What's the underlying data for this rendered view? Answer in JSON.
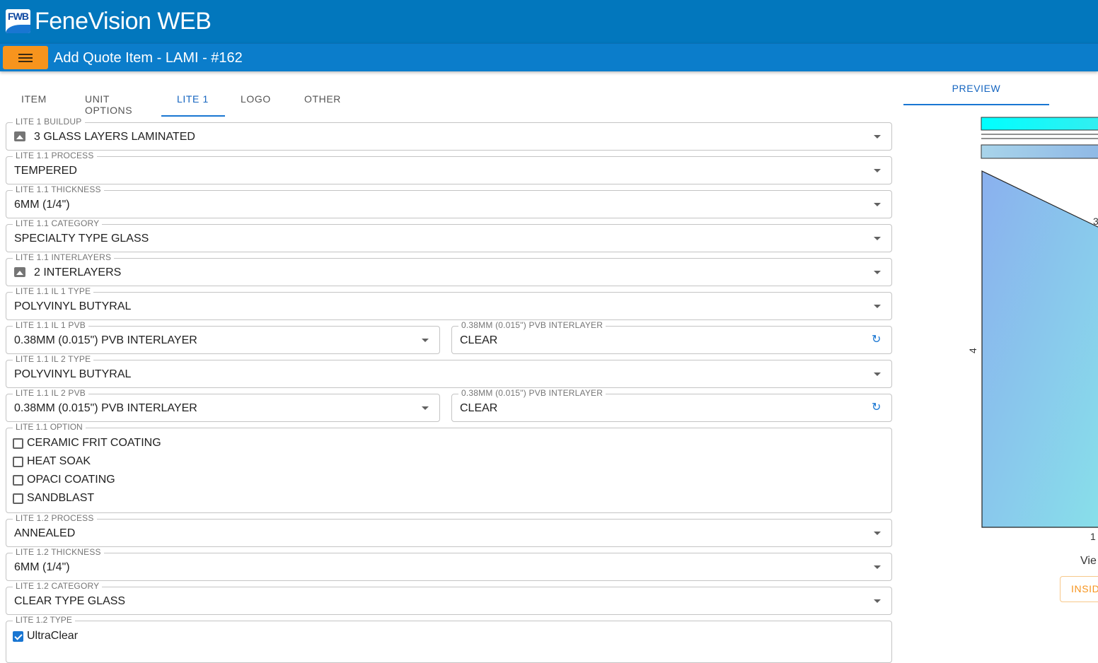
{
  "app": {
    "logo_text": "FWB",
    "name": "FeneVision WEB"
  },
  "header": {
    "title": "Add Quote Item - LAMI - #162"
  },
  "tabs": [
    {
      "label": "ITEM",
      "active": false
    },
    {
      "label": "UNIT OPTIONS",
      "active": false
    },
    {
      "label": "LITE 1",
      "active": true
    },
    {
      "label": "LOGO",
      "active": false
    },
    {
      "label": "OTHER",
      "active": false
    }
  ],
  "fields": {
    "buildup": {
      "label": "LITE 1 BUILDUP",
      "value": "3 GLASS LAYERS LAMINATED",
      "icon": "image-icon"
    },
    "l11_process": {
      "label": "LITE 1.1 PROCESS",
      "value": "TEMPERED"
    },
    "l11_thickness": {
      "label": "LITE 1.1 THICKNESS",
      "value": "6MM (1/4\")"
    },
    "l11_category": {
      "label": "LITE 1.1 CATEGORY",
      "value": "SPECIALTY TYPE GLASS"
    },
    "l11_interlayers": {
      "label": "LITE 1.1 INTERLAYERS",
      "value": "2 INTERLAYERS",
      "icon": "image-icon"
    },
    "l11_il1_type": {
      "label": "LITE 1.1 IL 1 TYPE",
      "value": "POLYVINYL BUTYRAL"
    },
    "l11_il1_pvb": {
      "label": "LITE 1.1 IL 1 PVB",
      "value": "0.38MM (0.015\") PVB INTERLAYER"
    },
    "l11_il1_color": {
      "label": "0.38MM (0.015\") PVB INTERLAYER",
      "value": "CLEAR"
    },
    "l11_il2_type": {
      "label": "LITE 1.1 IL 2 TYPE",
      "value": "POLYVINYL BUTYRAL"
    },
    "l11_il2_pvb": {
      "label": "LITE 1.1 IL 2 PVB",
      "value": "0.38MM (0.015\") PVB INTERLAYER"
    },
    "l11_il2_color": {
      "label": "0.38MM (0.015\") PVB INTERLAYER",
      "value": "CLEAR"
    },
    "l12_process": {
      "label": "LITE 1.2 PROCESS",
      "value": "ANNEALED"
    },
    "l12_thickness": {
      "label": "LITE 1.2 THICKNESS",
      "value": "6MM (1/4\")"
    },
    "l12_category": {
      "label": "LITE 1.2 CATEGORY",
      "value": "CLEAR TYPE GLASS"
    }
  },
  "l11_option": {
    "label": "LITE 1.1 OPTION",
    "options": [
      {
        "label": "CERAMIC FRIT COATING",
        "checked": false
      },
      {
        "label": "HEAT SOAK",
        "checked": false
      },
      {
        "label": "OPACI COATING",
        "checked": false
      },
      {
        "label": "SANDBLAST",
        "checked": false
      }
    ]
  },
  "l12_type": {
    "label": "LITE 1.2 TYPE",
    "options": [
      {
        "label": "UltraClear",
        "checked": true
      }
    ]
  },
  "preview": {
    "tab_label": "PREVIEW",
    "dim_left": "4",
    "dim_top": "3",
    "dim_bottom": "1",
    "view_label": "Vie",
    "side_button": "INSID"
  },
  "colors": {
    "brand": "#0277bd",
    "accent": "#f7941d",
    "active_tab": "#1976d2"
  }
}
